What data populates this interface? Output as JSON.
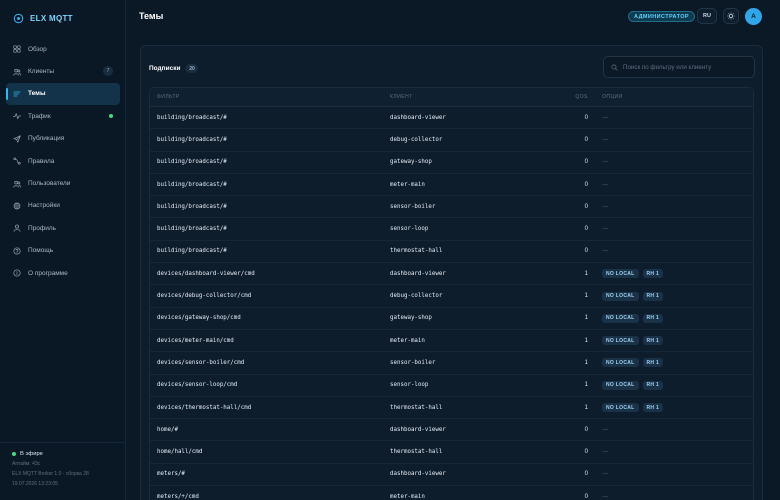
{
  "app": {
    "name": "ELX MQTT"
  },
  "sidebar": {
    "items": [
      {
        "label": "Обзор",
        "icon": "grid-icon"
      },
      {
        "label": "Клиенты",
        "icon": "users-icon",
        "badge": "7"
      },
      {
        "label": "Темы",
        "icon": "list-icon",
        "active": true
      },
      {
        "label": "Трафик",
        "icon": "activity-icon",
        "live": true
      },
      {
        "label": "Публикация",
        "icon": "send-icon"
      },
      {
        "label": "Правила",
        "icon": "rules-icon"
      },
      {
        "label": "Пользователи",
        "icon": "user-group-icon"
      },
      {
        "label": "Настройки",
        "icon": "gear-icon"
      },
      {
        "label": "Профиль",
        "icon": "user-icon"
      },
      {
        "label": "Помощь",
        "icon": "help-icon"
      },
      {
        "label": "О программе",
        "icon": "info-icon"
      }
    ],
    "footer": {
      "status": "В эфире",
      "uptime": "Аптайм: 43с",
      "version": "ELX MQTT Broker 1.0 · сборка 28",
      "timestamp": "19.07.2026 13:23:05"
    }
  },
  "header": {
    "title": "Темы",
    "role": "АДМИНИСТРАТОР",
    "lang": "RU",
    "avatar": "A"
  },
  "subscriptions": {
    "title": "Подписки",
    "count": "20",
    "search_placeholder": "Поиск по фильтру или клиенту",
    "columns": {
      "filter": "ФИЛЬТР",
      "client": "КЛИЕНТ",
      "qos": "QOS",
      "options": "ОПЦИИ"
    },
    "rows": [
      {
        "filter": "building/broadcast/#",
        "client": "dashboard-viewer",
        "qos": "0",
        "options": []
      },
      {
        "filter": "building/broadcast/#",
        "client": "debug-collector",
        "qos": "0",
        "options": []
      },
      {
        "filter": "building/broadcast/#",
        "client": "gateway-shop",
        "qos": "0",
        "options": []
      },
      {
        "filter": "building/broadcast/#",
        "client": "meter-main",
        "qos": "0",
        "options": []
      },
      {
        "filter": "building/broadcast/#",
        "client": "sensor-boiler",
        "qos": "0",
        "options": []
      },
      {
        "filter": "building/broadcast/#",
        "client": "sensor-loop",
        "qos": "0",
        "options": []
      },
      {
        "filter": "building/broadcast/#",
        "client": "thermostat-hall",
        "qos": "0",
        "options": []
      },
      {
        "filter": "devices/dashboard-viewer/cmd",
        "client": "dashboard-viewer",
        "qos": "1",
        "options": [
          "NO LOCAL",
          "RH 1"
        ]
      },
      {
        "filter": "devices/debug-collector/cmd",
        "client": "debug-collector",
        "qos": "1",
        "options": [
          "NO LOCAL",
          "RH 1"
        ]
      },
      {
        "filter": "devices/gateway-shop/cmd",
        "client": "gateway-shop",
        "qos": "1",
        "options": [
          "NO LOCAL",
          "RH 1"
        ]
      },
      {
        "filter": "devices/meter-main/cmd",
        "client": "meter-main",
        "qos": "1",
        "options": [
          "NO LOCAL",
          "RH 1"
        ]
      },
      {
        "filter": "devices/sensor-boiler/cmd",
        "client": "sensor-boiler",
        "qos": "1",
        "options": [
          "NO LOCAL",
          "RH 1"
        ]
      },
      {
        "filter": "devices/sensor-loop/cmd",
        "client": "sensor-loop",
        "qos": "1",
        "options": [
          "NO LOCAL",
          "RH 1"
        ]
      },
      {
        "filter": "devices/thermostat-hall/cmd",
        "client": "thermostat-hall",
        "qos": "1",
        "options": [
          "NO LOCAL",
          "RH 1"
        ]
      },
      {
        "filter": "home/#",
        "client": "dashboard-viewer",
        "qos": "0",
        "options": []
      },
      {
        "filter": "home/hall/cmd",
        "client": "thermostat-hall",
        "qos": "0",
        "options": []
      },
      {
        "filter": "meters/#",
        "client": "dashboard-viewer",
        "qos": "0",
        "options": []
      },
      {
        "filter": "meters/+/cmd",
        "client": "meter-main",
        "qos": "0",
        "options": []
      }
    ],
    "empty_option": "—"
  },
  "colors": {
    "accent": "#33b6f0",
    "live": "#3ddc84",
    "background": "#0b1826"
  }
}
